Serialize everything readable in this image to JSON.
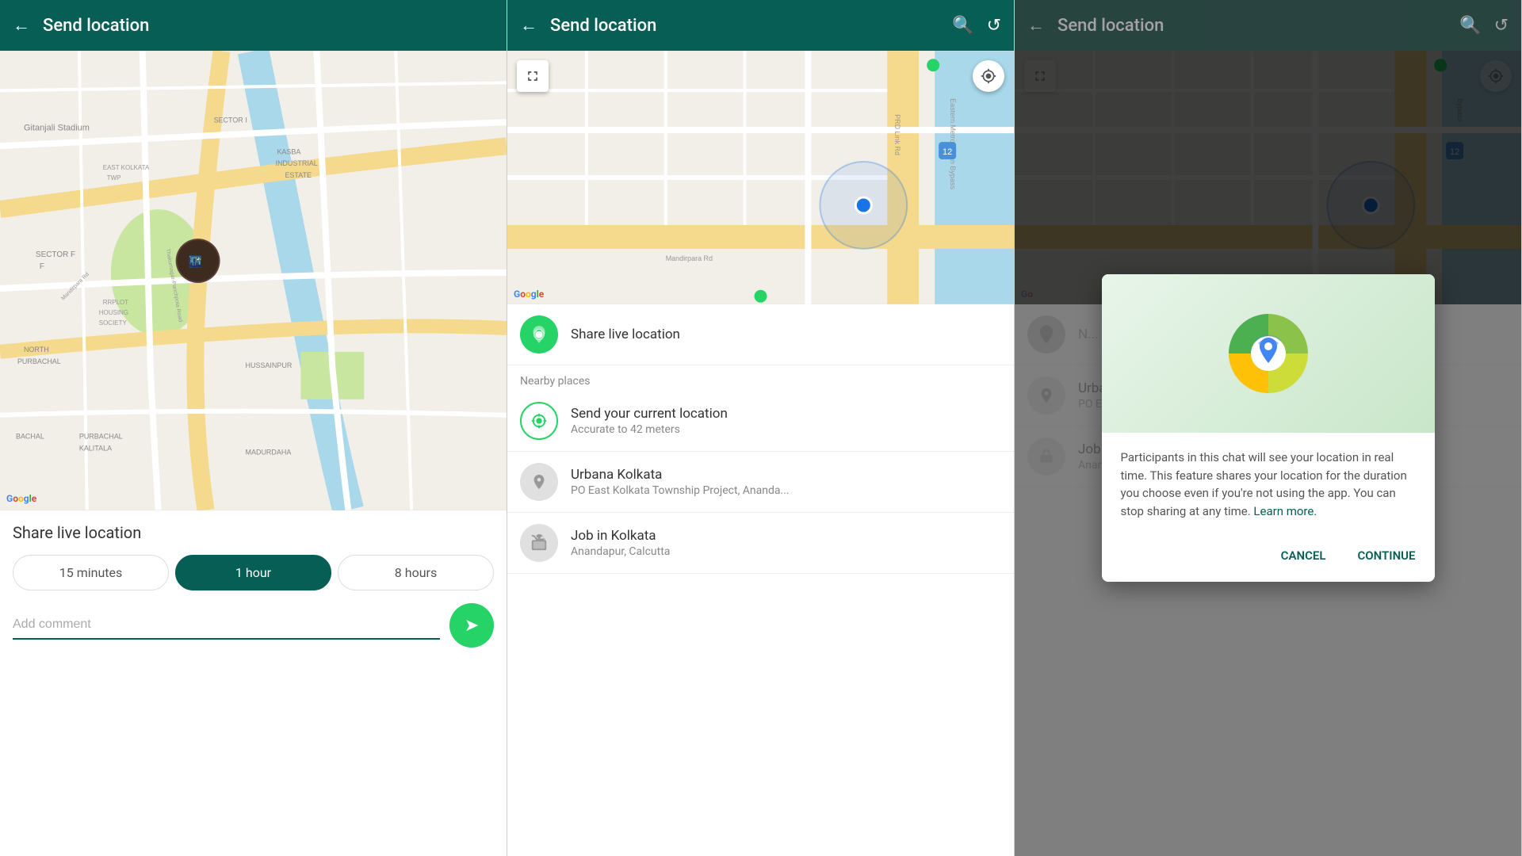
{
  "panels": [
    {
      "id": "panel1",
      "header": {
        "title": "Send location",
        "back_label": "←"
      },
      "share_live": {
        "title": "Share live location",
        "durations": [
          {
            "label": "15 minutes",
            "active": false
          },
          {
            "label": "1 hour",
            "active": true
          },
          {
            "label": "8 hours",
            "active": false
          }
        ],
        "comment_placeholder": "Add comment"
      }
    },
    {
      "id": "panel2",
      "header": {
        "title": "Send location",
        "back_label": "←",
        "search_label": "🔍",
        "refresh_label": "↺"
      },
      "share_live_item": {
        "title": "Share live location"
      },
      "nearby_label": "Nearby places",
      "locations": [
        {
          "title": "Send your current location",
          "subtitle": "Accurate to 42 meters",
          "icon_type": "teal-outline"
        },
        {
          "title": "Urbana Kolkata",
          "subtitle": "PO East Kolkata Township Project, Ananda...",
          "icon_type": "gray"
        },
        {
          "title": "Job in Kolkata",
          "subtitle": "Anandapur, Calcutta",
          "icon_type": "gray"
        }
      ]
    },
    {
      "id": "panel3",
      "header": {
        "title": "Send location",
        "back_label": "←",
        "search_label": "🔍",
        "refresh_label": "↺"
      },
      "dialog": {
        "body_text": "Participants in this chat will see your location in real time. This feature shares your location for the duration you choose even if you're not using the app. You can stop sharing at any time.",
        "link_text": "Learn more.",
        "cancel_label": "CANCEL",
        "continue_label": "CONTINUE"
      },
      "dimmed_locations": [
        {
          "title": "Urbana Kolkata",
          "subtitle": "PO East Kolkata Township Project, Ananda...",
          "icon_type": "gray"
        },
        {
          "title": "Job in Kolkata",
          "subtitle": "Anandapur, Calcutta",
          "icon_type": "gray"
        }
      ]
    }
  ]
}
